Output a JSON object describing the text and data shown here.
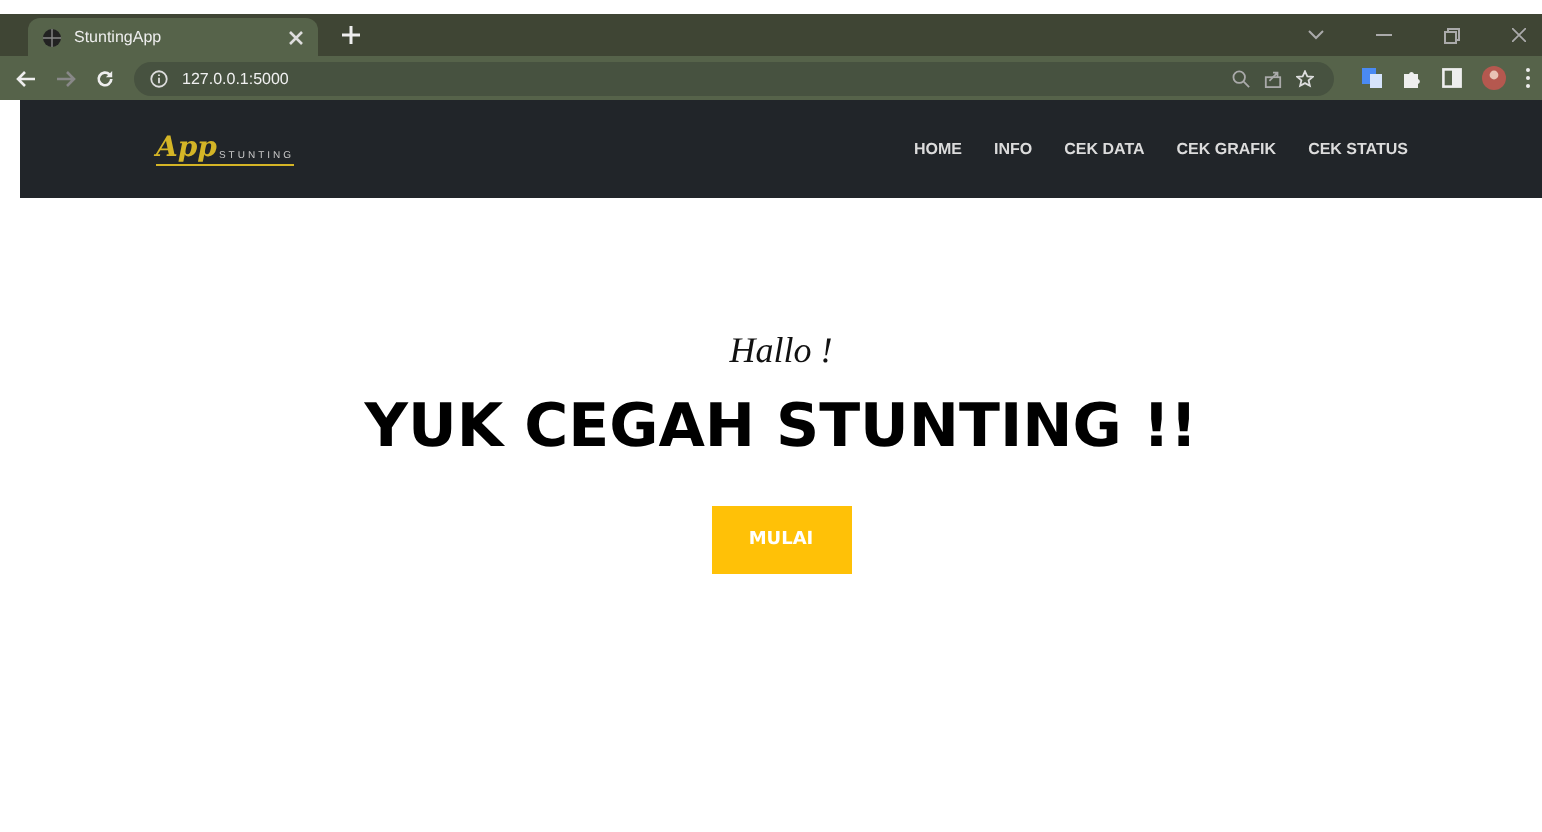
{
  "browser": {
    "tab_title": "StuntingApp",
    "url": "127.0.0.1:5000"
  },
  "navbar": {
    "logo_script": "App",
    "logo_sub": "STUNTING",
    "items": [
      "HOME",
      "INFO",
      "CEK DATA",
      "CEK GRAFIK",
      "CEK STATUS"
    ]
  },
  "hero": {
    "greeting": "Hallo !",
    "headline": "YUK CEGAH STUNTING !!",
    "button": "MULAI"
  }
}
